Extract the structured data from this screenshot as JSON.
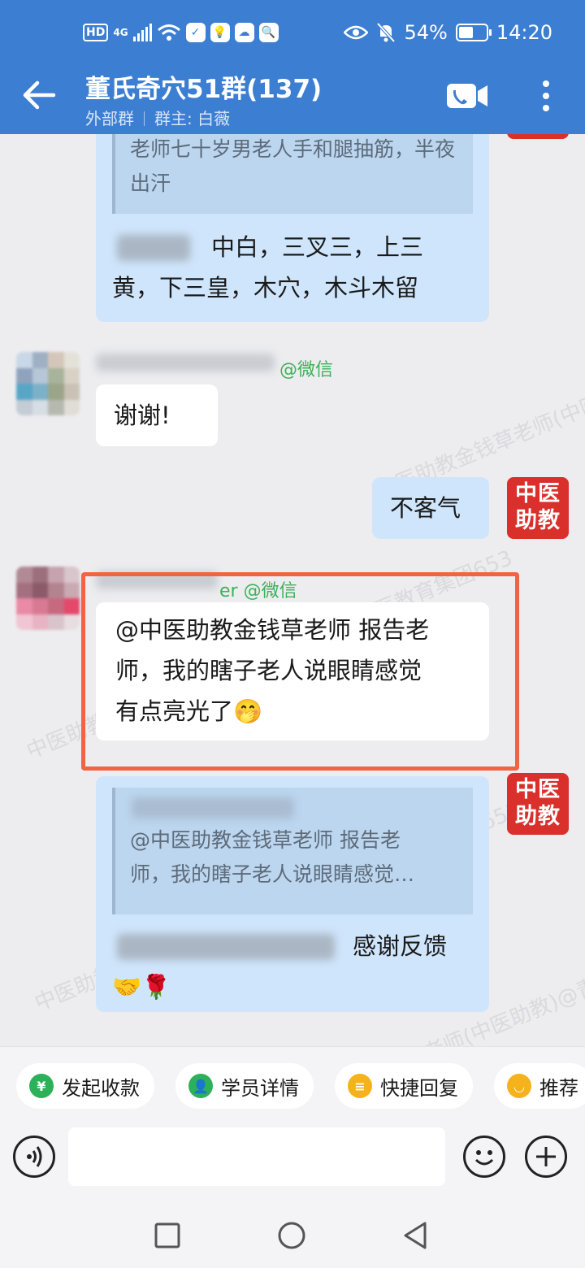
{
  "status_bar": {
    "hd": "HD",
    "signal": "4G",
    "battery": "54%",
    "time": "14:20"
  },
  "header": {
    "title": "董氏奇穴51群(137)",
    "external_tag": "外部群",
    "owner": "群主: 白薇"
  },
  "messages": {
    "m1_quote": "老师七十岁男老人手和腿抽筋，半夜出汗",
    "m1_text_line1": "中白，三叉三，上三",
    "m1_text_line2": "黄，下三皇，木穴，木斗木留",
    "m2_sender_suffix": "@微信",
    "m2_text": "谢谢!",
    "m3_text": "不客气",
    "m4_sender_suffix": "er @微信",
    "m4_line1": "@中医助教金钱草老师 报告老",
    "m4_line2": "师，我的瞎子老人说眼睛感觉",
    "m4_line3": "有点亮光了",
    "m4_emoji": "🤭",
    "m5_quote_line1": "@中医助教金钱草老师 报告老",
    "m5_quote_line2": "师，我的瞎子老人说眼睛感觉…",
    "m5_text": "感谢反馈",
    "m5_emojis": "🤝🌹"
  },
  "badge": {
    "line1": "中医",
    "line2": "助教"
  },
  "watermark": "中医助教金钱草老师(中医助教)@青岛中医教育集团653",
  "quick_actions": [
    {
      "label": "发起收款",
      "icon": "yen-shield-icon",
      "color": "#2db158"
    },
    {
      "label": "学员详情",
      "icon": "user-icon",
      "color": "#2db158"
    },
    {
      "label": "快捷回复",
      "icon": "quick-reply-icon",
      "color": "#f5b21b"
    },
    {
      "label": "推荐",
      "icon": "recommend-icon",
      "color": "#f5b21b"
    }
  ],
  "colors": {
    "header_bg": "#3c7ed2",
    "bubble_out": "#cfe5fb",
    "badge_red": "#d9302c",
    "highlight": "#f2643f"
  }
}
